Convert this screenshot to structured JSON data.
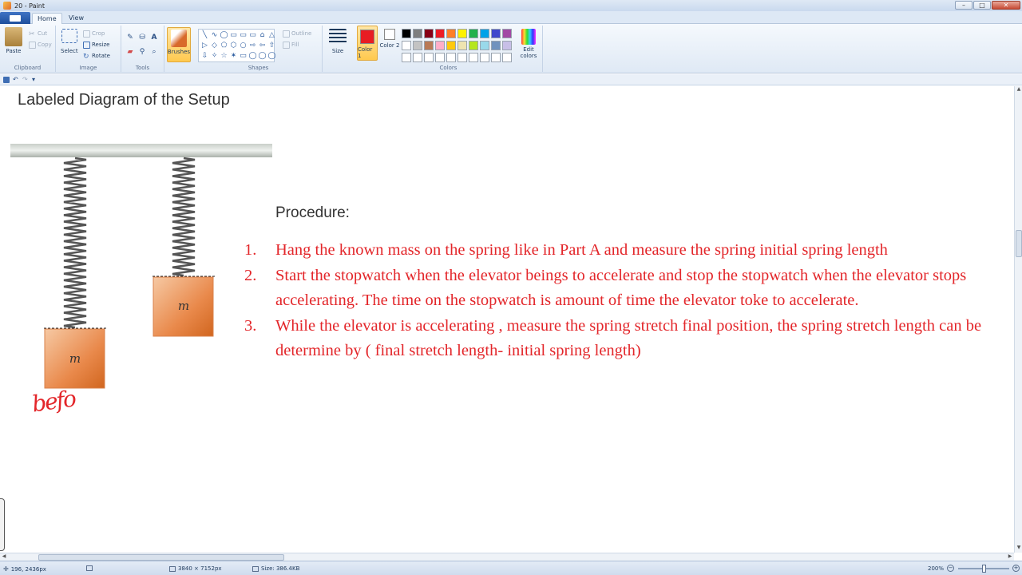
{
  "window": {
    "title": "20 - Paint",
    "buttons": {
      "minimize": "–",
      "maximize": "□",
      "close": "✕"
    }
  },
  "tabs": {
    "home": "Home",
    "view": "View"
  },
  "ribbon": {
    "clipboard": {
      "label": "Clipboard",
      "paste": "Paste",
      "cut": "Cut",
      "copy": "Copy"
    },
    "image": {
      "label": "Image",
      "select": "Select",
      "crop": "Crop",
      "resize": "Resize",
      "rotate": "Rotate"
    },
    "tools": {
      "label": "Tools"
    },
    "brushes": {
      "label": "Brushes"
    },
    "shapes": {
      "label": "Shapes",
      "outline": "Outline",
      "fill": "Fill",
      "glyphs": [
        "╲",
        "∿",
        "◯",
        "▭",
        "▭",
        "▭",
        "⌂",
        "△",
        "▷",
        "◇",
        "⬠",
        "⬡",
        "○",
        "⇨",
        "⇦",
        "⇧",
        "⇩",
        "✧",
        "☆",
        "✶",
        "▭",
        "◯",
        "◯",
        "◯"
      ]
    },
    "size": {
      "label": "Size"
    },
    "colors": {
      "label": "Colors",
      "color1": "Color 1",
      "color2": "Color 2",
      "edit": "Edit colors",
      "color1_value": "#e81c23",
      "color2_value": "#ffffff",
      "palette": [
        "#000000",
        "#7f7f7f",
        "#880015",
        "#ed1c24",
        "#ff7f27",
        "#fff200",
        "#22b14c",
        "#00a2e8",
        "#3f48cc",
        "#a349a4",
        "#ffffff",
        "#c3c3c3",
        "#b97a57",
        "#ffaec9",
        "#ffc90e",
        "#efe4b0",
        "#b5e61d",
        "#99d9ea",
        "#7092be",
        "#c8bfe7",
        "#ffffff",
        "#ffffff",
        "#ffffff",
        "#ffffff",
        "#ffffff",
        "#ffffff",
        "#ffffff",
        "#ffffff",
        "#ffffff",
        "#ffffff"
      ]
    }
  },
  "canvas": {
    "page_title": "Labeled Diagram of the Setup",
    "procedure_heading": "Procedure:",
    "mass_label": "m",
    "handwriting": "befo",
    "steps": [
      {
        "num": "1.",
        "text": "Hang the known mass on the spring like in Part A and measure the spring initial spring length"
      },
      {
        "num": "2.",
        "text": "Start the stopwatch when the elevator beings to accelerate and stop the stopwatch when the elevator stops accelerating. The time on the stopwatch is amount of time the elevator toke to accelerate."
      },
      {
        "num": "3.",
        "text": "While the elevator is accelerating , measure the spring stretch final position, the spring stretch length can be determine by ( final stretch length- initial spring length)"
      }
    ]
  },
  "status": {
    "cursor": "196, 2436px",
    "dimensions": "3840 × 7152px",
    "size": "Size: 386.4KB",
    "zoom": "200%"
  },
  "colors": {
    "accent_text": "#e3262a",
    "ribbon_text": "#1e395b"
  }
}
